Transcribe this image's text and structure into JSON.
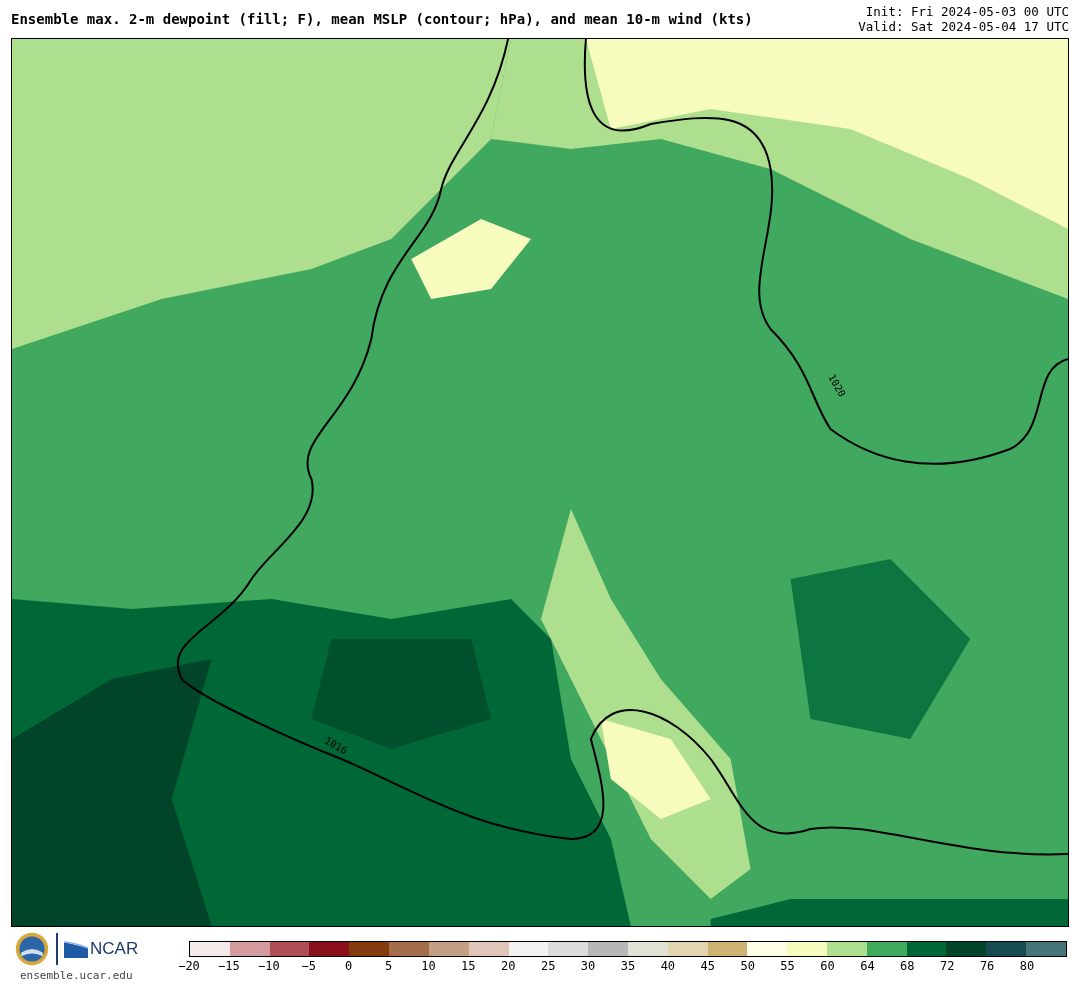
{
  "title": "Ensemble max. 2-m dewpoint (fill; F), mean MSLP (contour; hPa), and mean 10-m wind (kts)",
  "init": "Init: Fri 2024-05-03 00 UTC",
  "valid": "Valid: Sat 2024-05-04 17 UTC",
  "map": {
    "contour_labels": [
      "1016",
      "1020"
    ]
  },
  "footer": {
    "logo_text": "NCAR",
    "site": "ensemble.ucar.edu"
  },
  "colorbar": [
    {
      "label": "−20",
      "color": "#f5e9e9"
    },
    {
      "label": "−15",
      "color": "#d29b9e"
    },
    {
      "label": "−10",
      "color": "#ad4f55"
    },
    {
      "label": "−5",
      "color": "#8a111c"
    },
    {
      "label": "0",
      "color": "#843c0f"
    },
    {
      "label": "5",
      "color": "#a46e4c"
    },
    {
      "label": "10",
      "color": "#c49f84"
    },
    {
      "label": "15",
      "color": "#e0c6b8"
    },
    {
      "label": "20",
      "color": "#f2f2f2"
    },
    {
      "label": "25",
      "color": "#dcdcdc"
    },
    {
      "label": "30",
      "color": "#b7b7b7"
    },
    {
      "label": "35",
      "color": "#e2e2d4"
    },
    {
      "label": "40",
      "color": "#e3d5ad"
    },
    {
      "label": "45",
      "color": "#cdb475"
    },
    {
      "label": "50",
      "color": "#fefee6"
    },
    {
      "label": "55",
      "color": "#f7fbbd"
    },
    {
      "label": "60",
      "color": "#addf8e"
    },
    {
      "label": "64",
      "color": "#41ab5d"
    },
    {
      "label": "68",
      "color": "#006837"
    },
    {
      "label": "72",
      "color": "#004529"
    },
    {
      "label": "76",
      "color": "#164b52"
    },
    {
      "label": "80",
      "color": "#457578"
    }
  ]
}
